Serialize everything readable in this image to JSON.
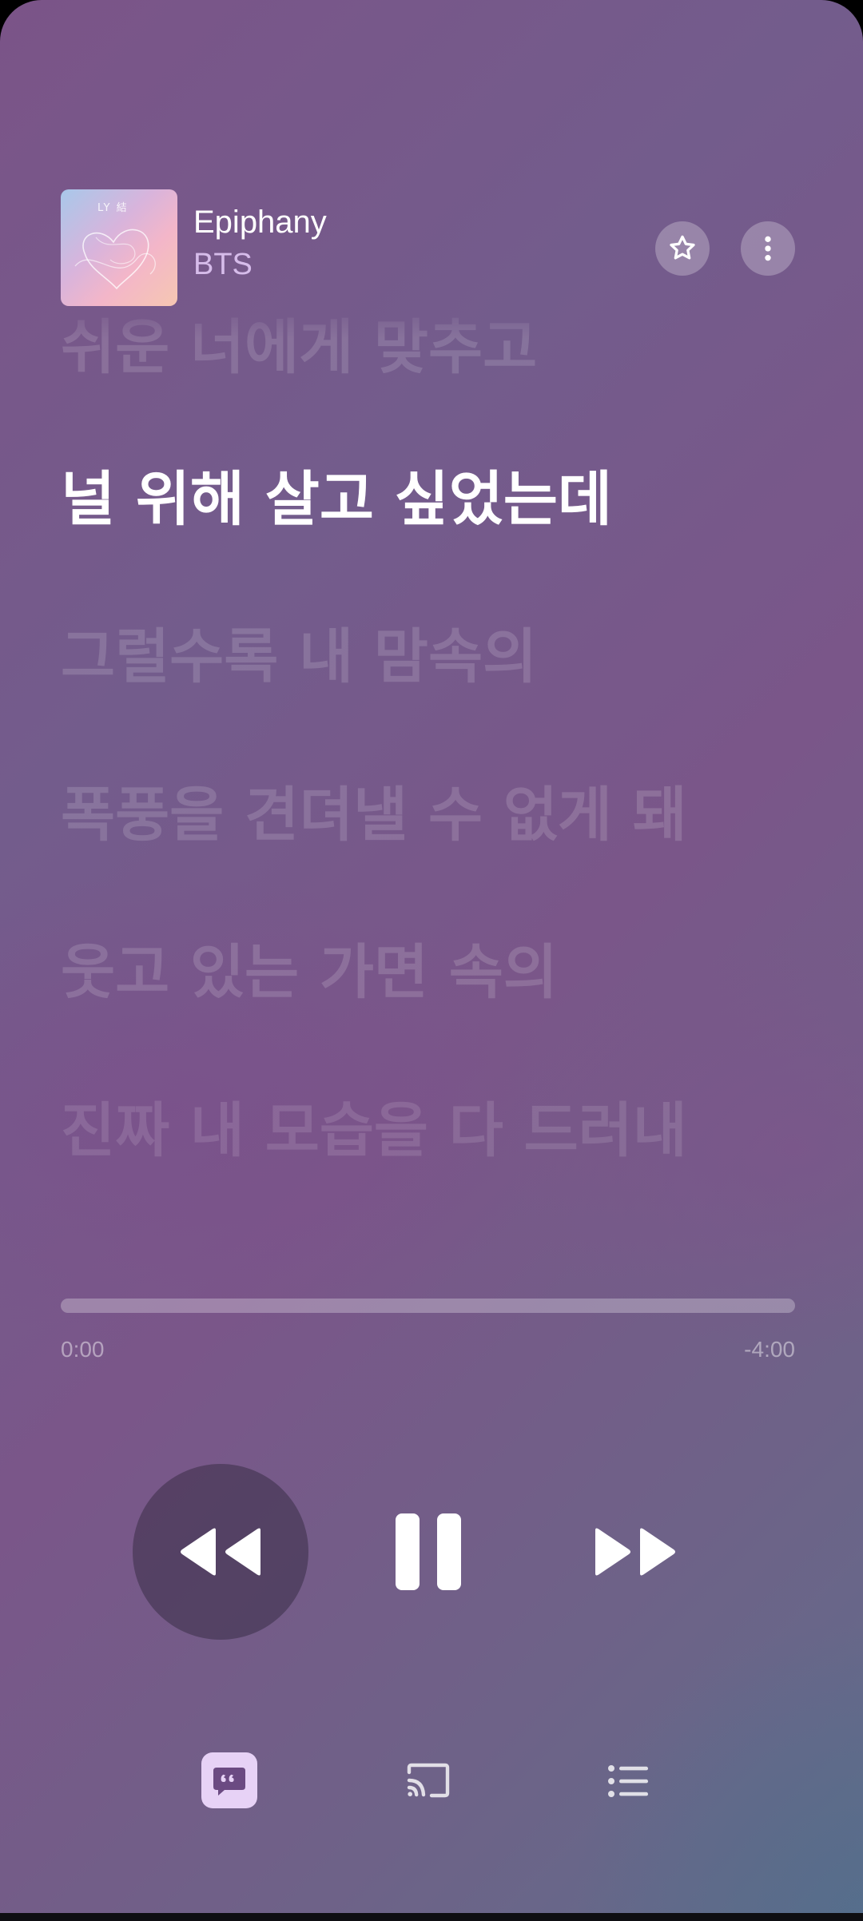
{
  "now_playing": {
    "title": "Epiphany",
    "artist": "BTS",
    "album_art_text": "LY 結"
  },
  "header_actions": {
    "favorite_icon": "star-icon",
    "more_icon": "more-vertical-icon"
  },
  "lyrics": {
    "previous_line": "쉬운 너에게 맞추고",
    "current_line": "널 위해 살고 싶었는데",
    "upcoming_lines": [
      "그럴수록 내 맘속의",
      "폭풍을 견뎌낼 수 없게 돼",
      "웃고 있는 가면 속의",
      "진짜 내 모습을 다 드러내"
    ]
  },
  "playback": {
    "elapsed": "0:00",
    "remaining": "-4:00",
    "progress_fraction": 0.0
  },
  "transport": {
    "rewind_icon": "rewind-icon",
    "pause_icon": "pause-icon",
    "forward_icon": "fast-forward-icon"
  },
  "toolbar": {
    "lyrics_icon": "lyrics-quote-icon",
    "cast_icon": "cast-icon",
    "queue_icon": "queue-list-icon"
  },
  "colors": {
    "accent_lyrics_button": "#e7d2f6",
    "active_lyric": "#ffffff"
  }
}
